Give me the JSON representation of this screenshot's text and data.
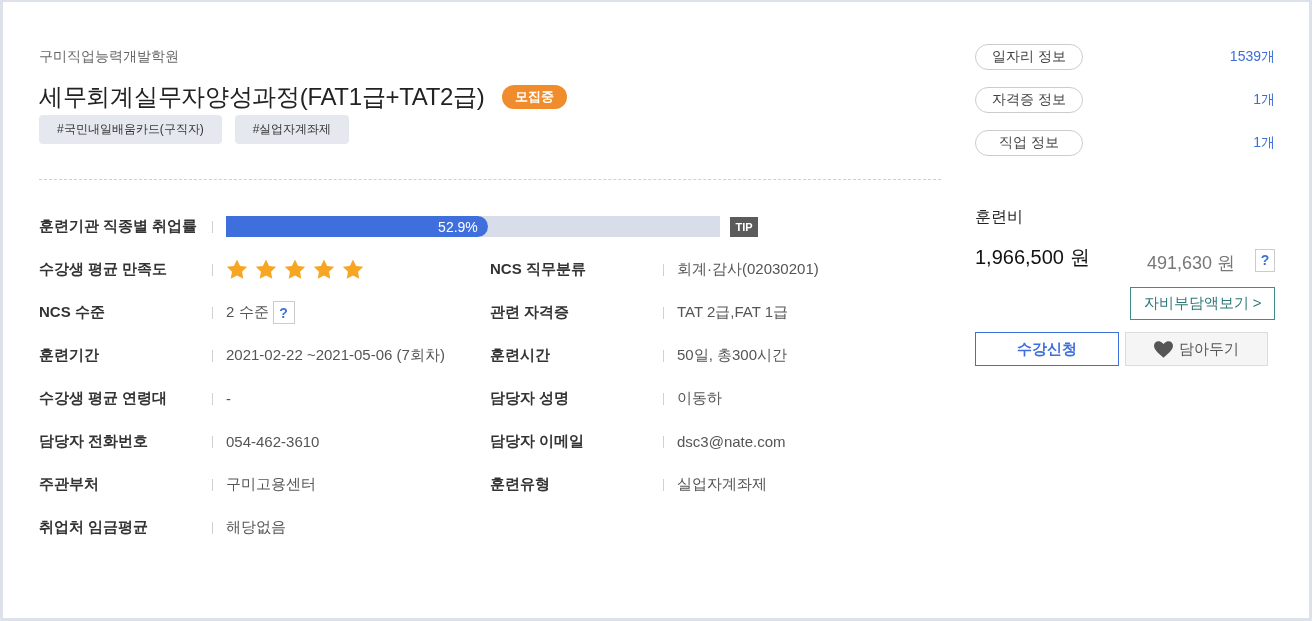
{
  "institution": "구미직업능력개발학원",
  "course": {
    "title": "세무회계실무자양성과정(FAT1급+TAT2급)",
    "status_badge": "모집중"
  },
  "tags": [
    "#국민내일배움카드(구직자)",
    "#실업자계좌제"
  ],
  "details": [
    {
      "kind": "bar",
      "label": "훈련기관 직종별 취업률",
      "level": 0.53,
      "reading": "52.9%",
      "tip": "TIP"
    },
    {
      "kind": "stars",
      "label": "수강생 평균 만족도",
      "stars": 5
    },
    {
      "kind": "text",
      "label": "NCS 직무분류",
      "value": "회계·감사(02030201)"
    },
    {
      "kind": "help",
      "label": "NCS 수준",
      "value": "2 수준",
      "help": "?"
    },
    {
      "kind": "text",
      "label": "관련 자격증",
      "value": "TAT 2급,FAT 1급"
    },
    {
      "kind": "text",
      "label": "훈련기간",
      "value": "2021-02-22 ~2021-05-06 (7회차)"
    },
    {
      "kind": "text",
      "label": "훈련시간",
      "value": "50일, 총300시간"
    },
    {
      "kind": "text",
      "label": "수강생 평균 연령대",
      "value": "-"
    },
    {
      "kind": "text",
      "label": "담당자 성명",
      "value": "이동하"
    },
    {
      "kind": "text",
      "label": "담당자 전화번호",
      "value": "054-462-3610"
    },
    {
      "kind": "text",
      "label": "담당자 이메일",
      "value": "dsc3@nate.com"
    },
    {
      "kind": "text",
      "label": "주관부처",
      "value": "구미고용센터"
    },
    {
      "kind": "text",
      "label": "훈련유형",
      "value": "실업자계좌제"
    },
    {
      "kind": "text",
      "label": "취업처 임금평균",
      "value": "해당없음"
    }
  ],
  "info_links": [
    {
      "label": "일자리 정보",
      "count": "1539개"
    },
    {
      "label": "자격증 정보",
      "count": "1개"
    },
    {
      "label": "직업 정보",
      "count": "1개"
    }
  ],
  "fee": {
    "title": "훈련비",
    "total": "1,966,500 원",
    "self_pay": "491,630 원",
    "help": "?",
    "detail_button": "자비부담액보기 >"
  },
  "actions": [
    {
      "kind": "apply",
      "label": "수강신청"
    },
    {
      "kind": "wishlist",
      "label": "담아두기"
    }
  ]
}
